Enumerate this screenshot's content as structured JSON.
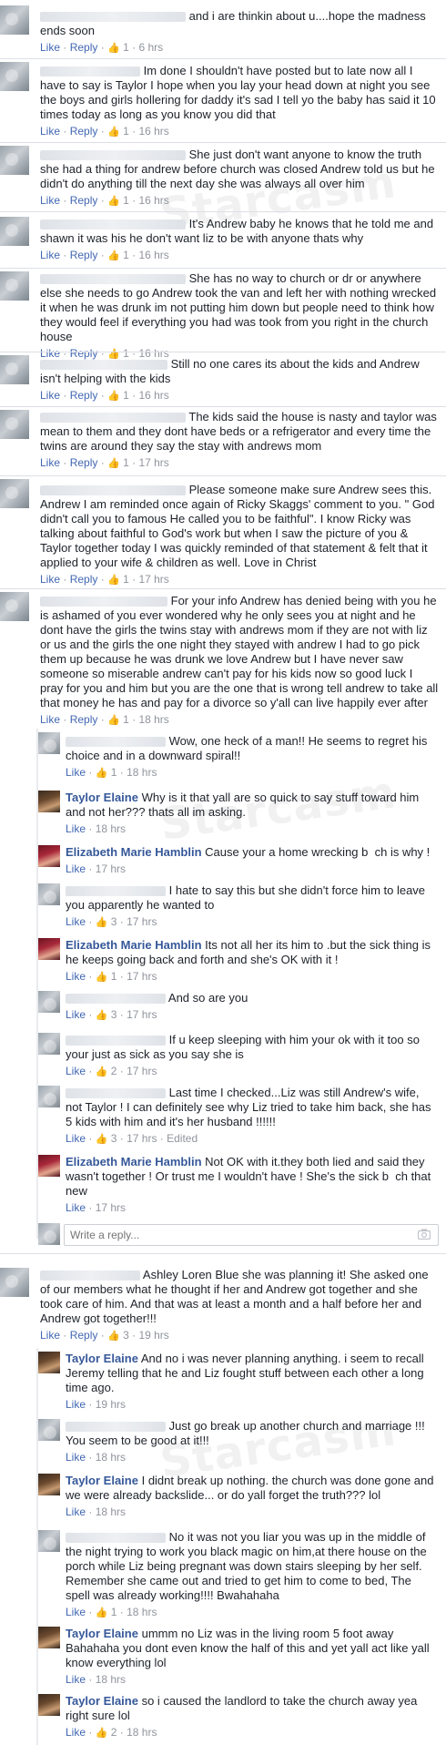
{
  "labels": {
    "like": "Like",
    "reply": "Reply",
    "dot": " · ",
    "edited": "Edited",
    "write_reply_placeholder": "Write a reply..."
  },
  "watermark": "Starcasm",
  "comments": [
    {
      "id": "c1",
      "text": "and i are thinkin about u....hope the madness ends soon",
      "likes": "1",
      "time": "6 hrs"
    },
    {
      "id": "c2",
      "text": "Im done I shouldn't have posted but to late now all I have to say is Taylor I hope when you lay your head down at night you see the boys and girls hollering for daddy it's sad I tell yo the baby has said it 10 times today as long as you know you did that",
      "likes": "1",
      "time": "16 hrs"
    },
    {
      "id": "c3",
      "text": "She just don't want anyone to know the truth she had a thing for andrew before church was closed Andrew told us but he didn't do anything till the next day she was always all over him",
      "likes": "1",
      "time": "16 hrs"
    },
    {
      "id": "c4",
      "text": "It's Andrew baby he knows that he told me and shawn it was his he don't want liz to be with anyone thats why",
      "likes": "1",
      "time": "16 hrs"
    },
    {
      "id": "c5",
      "text": "She has no way to church or dr or anywhere else she needs to go Andrew took the van and left her with nothing wrecked it when he was drunk im not putting him down but people need to think how they would feel if everything you had was took from you right in the church house",
      "likes": "1",
      "time": "16 hrs"
    },
    {
      "id": "c6",
      "text": "Still no one cares its about the kids and Andrew isn't helping with the kids",
      "likes": "1",
      "time": "16 hrs"
    },
    {
      "id": "c7",
      "text": "The kids said the house is nasty and taylor was mean to them and they dont have beds or a refrigerator and every time the twins are around they say the stay with andrews mom",
      "likes": "1",
      "time": "17 hrs"
    },
    {
      "id": "c8",
      "text": "Please someone make sure Andrew sees this. Andrew I am reminded once again of Ricky Skaggs' comment to you. \" God didn't call you to famous He called you to be faithful\". I know Ricky was talking about faithful to God's work but when I saw the picture of you & Taylor together today I was quickly reminded of that statement & felt that it applied to your wife & children as well. Love in Christ",
      "likes": "1",
      "time": "17 hrs"
    },
    {
      "id": "c9",
      "text": "For your info Andrew has denied being with you he is ashamed of you ever wondered why he only sees you at night and he dont have the girls the twins stay with andrews mom if they are not with liz or us and the girls the one night they stayed with andrew I had to go pick them up because he was drunk we love Andrew but I have never saw someone so miserable andrew can't pay for his kids now so good luck I pray for you and him but you are the one that is wrong tell andrew to take all that money he has and pay for a divorce so y'all can live happily ever after",
      "likes": "1",
      "time": "18 hrs"
    }
  ],
  "replies1": [
    {
      "id": "r1",
      "name": "",
      "text": "Wow, one heck of a man!! He seems to regret his choice and in a downward spiral!!",
      "likes": "1",
      "time": "18 hrs"
    },
    {
      "id": "r2",
      "name": "Taylor Elaine",
      "text": "Why is it that yall are so quick to say stuff toward him and not her??? thats all im asking.",
      "likes": "",
      "time": "18 hrs"
    },
    {
      "id": "r3",
      "name": "Elizabeth Marie Hamblin",
      "text": "Cause your a home wrecking b  ch is why !",
      "likes": "",
      "time": "17 hrs"
    },
    {
      "id": "r4",
      "name": "",
      "text": "I hate to say this but she didn't force him to leave you apparently he wanted to",
      "likes": "3",
      "time": "17 hrs"
    },
    {
      "id": "r5",
      "name": "Elizabeth Marie Hamblin",
      "text": "Its not all her its him to .but the sick thing is he keeps going back and forth and she's OK with it !",
      "likes": "1",
      "time": "17 hrs"
    },
    {
      "id": "r6",
      "name": "",
      "text": "And so are you",
      "likes": "3",
      "time": "17 hrs"
    },
    {
      "id": "r7",
      "name": "",
      "text": "If u keep sleeping with him your ok with it too so your just as sick as you say she is",
      "likes": "2",
      "time": "17 hrs"
    },
    {
      "id": "r8",
      "name": "",
      "text": "Last time I checked...Liz was still Andrew's wife, not Taylor ! I can definitely see why Liz tried to take him back, she has 5 kids with him and it's her husband !!!!!!",
      "likes": "3",
      "time": "17 hrs"
    },
    {
      "id": "r9",
      "name": "Elizabeth Marie Hamblin",
      "text": "Not OK with it.they both lied and said they wasn't together ! Or trust me I wouldn't have ! She's the sick b  ch that new",
      "likes": "",
      "time": "17 hrs"
    }
  ],
  "comment10": {
    "text": "Ashley Loren Blue she was planning it! She asked one of our members what he thought if her and Andrew got together and she took care of him. And that was at least a month and a half before her and Andrew got together!!!",
    "likes": "3",
    "time": "19 hrs"
  },
  "replies2": [
    {
      "id": "s1",
      "name": "Taylor Elaine",
      "text": "And no i was never planning anything. i seem to recall Jeremy telling that he and Liz fought stuff between each other a long time ago.",
      "likes": "",
      "time": "19 hrs"
    },
    {
      "id": "s2",
      "name": "",
      "text": "Just go break up another church and marriage !!! You seem to be good at it!!!",
      "likes": "",
      "time": "18 hrs"
    },
    {
      "id": "s3",
      "name": "Taylor Elaine",
      "text": "I didnt break up nothing. the church was done gone and we were already backslide... or do yall forget the truth??? lol",
      "likes": "",
      "time": "18 hrs"
    },
    {
      "id": "s4",
      "name": "",
      "text": "No it was not you liar you was up in the middle of the night trying to work you black magic on him,at there house on the porch while Liz being pregnant was down stairs sleeping by her self. Remember she came out and tried to get him to come to bed, The spell was already working!!!! Bwahahaha",
      "likes": "1",
      "time": "18 hrs"
    },
    {
      "id": "s5",
      "name": "Taylor Elaine",
      "text": "ummm no Liz was in the living room 5 foot away Bahahaha you dont even know the half of this and yet yall act like yall know everything lol",
      "likes": "",
      "time": "18 hrs"
    },
    {
      "id": "s6",
      "name": "Taylor Elaine",
      "text": "so i caused the landlord to take the church away yea right sure lol",
      "likes": "2",
      "time": "18 hrs"
    }
  ]
}
